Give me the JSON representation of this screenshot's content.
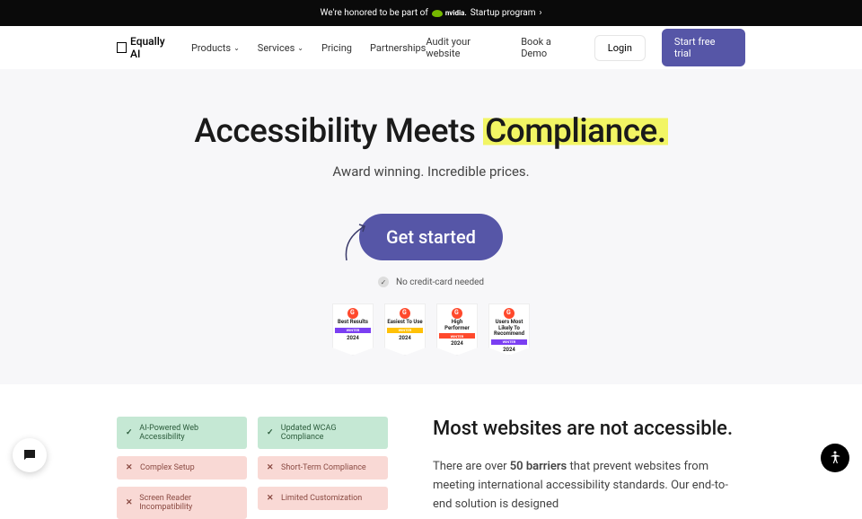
{
  "topbar": {
    "prefix": "We're honored to be part of",
    "brand": "nvidia.",
    "suffix": "Startup program"
  },
  "logo": {
    "name": "Equally AI"
  },
  "nav": {
    "products": "Products",
    "services": "Services",
    "pricing": "Pricing",
    "partnerships": "Partnerships",
    "audit": "Audit your website",
    "demo": "Book a Demo",
    "login": "Login",
    "trial": "Start free trial"
  },
  "hero": {
    "title_a": "Accessibility Meets ",
    "title_b": "Compliance.",
    "subtitle": "Award winning. Incredible prices.",
    "cta": "Get started",
    "nocard": "No credit-card needed"
  },
  "badges": [
    {
      "title": "Best Results",
      "ribbon": "WINTER",
      "year": "2024",
      "color": "ribbon-purple"
    },
    {
      "title": "Easiest To Use",
      "ribbon": "WINTER",
      "year": "2024",
      "color": "ribbon-yellow"
    },
    {
      "title": "High Performer",
      "ribbon": "WINTER",
      "year": "2024",
      "color": "ribbon-red"
    },
    {
      "title": "Users Most Likely To Recommend",
      "ribbon": "WINTER",
      "year": "2024",
      "color": "ribbon-purple"
    }
  ],
  "features": {
    "col1": [
      {
        "good": true,
        "text": "AI-Powered Web Accessibility"
      },
      {
        "good": false,
        "text": "Complex Setup"
      },
      {
        "good": false,
        "text": "Screen Reader Incompatibility"
      }
    ],
    "col2": [
      {
        "good": true,
        "text": "Updated WCAG Compliance"
      },
      {
        "good": false,
        "text": "Short-Term Compliance"
      },
      {
        "good": false,
        "text": "Limited Customization"
      }
    ]
  },
  "lower": {
    "heading": "Most websites are not accessible.",
    "text_a": "There are over ",
    "text_b": "50 barriers",
    "text_c": " that prevent websites from meeting international accessibility standards. Our end-to-end solution is designed"
  }
}
